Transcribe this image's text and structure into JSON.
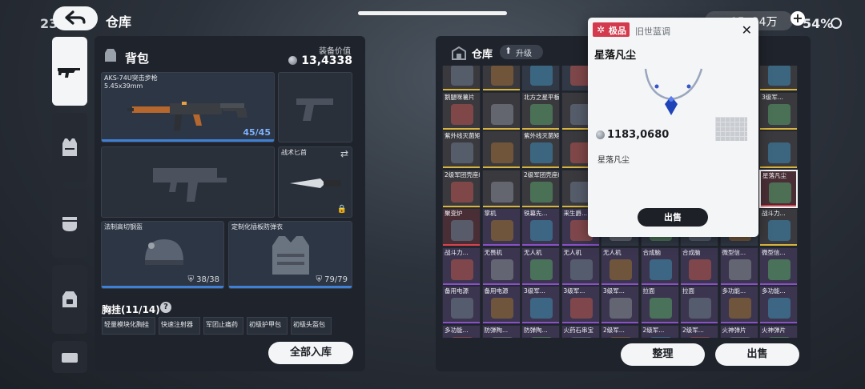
{
  "status_bar": {
    "clock": "23",
    "battery": "54%",
    "currency": "95, 24万"
  },
  "header": {
    "title": "仓库"
  },
  "backpack": {
    "title": "背包",
    "value_label": "装备价值",
    "value": "13,4338",
    "weapon": {
      "name": "AKS-74U突击步枪",
      "caliber": "5.45x39mm",
      "ammo": "45/45"
    },
    "knife": {
      "name": "战术匕首"
    },
    "helmet": {
      "name": "法制高切钢盔",
      "durability": "38/38"
    },
    "armor": {
      "name": "定制化插板防弹衣",
      "durability": "79/79"
    }
  },
  "chest_rig": {
    "title": "胸挂(11/14)",
    "items": [
      "轻量模块化胸挂",
      "快速注射器",
      "军团止痛药",
      "初级护甲包",
      "初级头盔包"
    ]
  },
  "buttons": {
    "store_all": "全部入库",
    "organize": "整理",
    "sell": "出售"
  },
  "warehouse": {
    "title": "仓库",
    "upgrade": "升级",
    "rows": [
      [
        {
          "label": "",
          "rarity": "gold"
        },
        {
          "label": "",
          "rarity": "gold"
        },
        {
          "label": "",
          "rarity": ""
        },
        {
          "label": "",
          "rarity": ""
        },
        {
          "label": "",
          "rarity": ""
        },
        {
          "label": "",
          "rarity": ""
        },
        {
          "label": "",
          "rarity": "gold"
        },
        {
          "label": "",
          "rarity": "gold"
        },
        {
          "label": "",
          "rarity": "gold"
        }
      ],
      [
        {
          "label": "鹅腿咪薯片",
          "rarity": "gold"
        },
        {
          "label": "",
          "rarity": "gold"
        },
        {
          "label": "北方之星平板电脑",
          "rarity": "gold"
        },
        {
          "label": "",
          "rarity": "gold"
        },
        {
          "label": "",
          "rarity": ""
        },
        {
          "label": "",
          "rarity": ""
        },
        {
          "label": "",
          "rarity": ""
        },
        {
          "label": "",
          "rarity": ""
        },
        {
          "label": "3级军...",
          "rarity": "gold"
        }
      ],
      [
        {
          "label": "紫外线灭菌矩阵",
          "rarity": "gold"
        },
        {
          "label": "",
          "rarity": "gold"
        },
        {
          "label": "紫外线灭菌矩阵",
          "rarity": "gold"
        },
        {
          "label": "",
          "rarity": "gold"
        },
        {
          "label": "",
          "rarity": ""
        },
        {
          "label": "",
          "rarity": ""
        },
        {
          "label": "",
          "rarity": ""
        },
        {
          "label": "",
          "rarity": ""
        },
        {
          "label": "",
          "rarity": "gold"
        }
      ],
      [
        {
          "label": "2级军团壳座组件",
          "rarity": "gold"
        },
        {
          "label": "",
          "rarity": "gold"
        },
        {
          "label": "2级军团壳座组件",
          "rarity": "gold"
        },
        {
          "label": "",
          "rarity": "gold"
        },
        {
          "label": "",
          "rarity": ""
        },
        {
          "label": "",
          "rarity": ""
        },
        {
          "label": "",
          "rarity": ""
        },
        {
          "label": "",
          "rarity": ""
        },
        {
          "label": "星落凡尘",
          "rarity": "red"
        }
      ],
      [
        {
          "label": "聚变炉",
          "rarity": "red"
        },
        {
          "label": "掌机",
          "rarity": "purple"
        },
        {
          "label": "铁幕先...",
          "rarity": "purple"
        },
        {
          "label": "来生爵...",
          "rarity": "purple"
        },
        {
          "label": "",
          "rarity": ""
        },
        {
          "label": "",
          "rarity": ""
        },
        {
          "label": "",
          "rarity": ""
        },
        {
          "label": "",
          "rarity": ""
        },
        {
          "label": "战斗力...",
          "rarity": "gold"
        }
      ],
      [
        {
          "label": "战斗力...",
          "rarity": "purple"
        },
        {
          "label": "无畏机",
          "rarity": "purple"
        },
        {
          "label": "无人机",
          "rarity": "purple"
        },
        {
          "label": "无人机",
          "rarity": "purple"
        },
        {
          "label": "无人机",
          "rarity": "purple"
        },
        {
          "label": "合成脑",
          "rarity": "purple"
        },
        {
          "label": "合成脑",
          "rarity": "purple"
        },
        {
          "label": "微型信...",
          "rarity": "purple"
        },
        {
          "label": "微型信...",
          "rarity": "purple"
        }
      ],
      [
        {
          "label": "备用电源",
          "rarity": "purple"
        },
        {
          "label": "备用电源",
          "rarity": "purple"
        },
        {
          "label": "3级军...",
          "rarity": "purple"
        },
        {
          "label": "3级军...",
          "rarity": "purple"
        },
        {
          "label": "3级军...",
          "rarity": "purple"
        },
        {
          "label": "拉面",
          "rarity": "purple"
        },
        {
          "label": "拉面",
          "rarity": "purple"
        },
        {
          "label": "多功能...",
          "rarity": "purple"
        },
        {
          "label": "多功能...",
          "rarity": "purple"
        }
      ],
      [
        {
          "label": "多功能...",
          "rarity": "purple"
        },
        {
          "label": "防弹陶...",
          "rarity": "purple"
        },
        {
          "label": "防弹陶...",
          "rarity": "purple"
        },
        {
          "label": "火药石串宝",
          "rarity": "purple"
        },
        {
          "label": "2级军...",
          "rarity": "purple"
        },
        {
          "label": "2级军...",
          "rarity": "purple"
        },
        {
          "label": "2级军...",
          "rarity": "purple"
        },
        {
          "label": "火神弹片",
          "rarity": "purple"
        },
        {
          "label": "火神弹片",
          "rarity": "purple"
        }
      ]
    ]
  },
  "popup": {
    "rarity": "极品",
    "set_name": "旧世蓝调",
    "item_name": "星落凡尘",
    "price": "1183,0680",
    "description": "星落凡尘",
    "sell": "出售"
  },
  "colors": {
    "gold": "#d9b43c",
    "purple": "#8a4fc9",
    "red": "#d9434f",
    "blue": "#3f7fd4",
    "badge": "#d43a4d"
  }
}
